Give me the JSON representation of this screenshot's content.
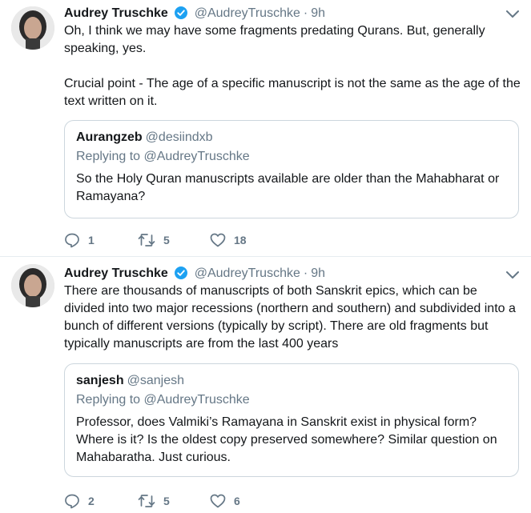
{
  "tweets": [
    {
      "author": "Audrey Truschke",
      "handle": "@AudreyTruschke",
      "separator": "·",
      "time": "9h",
      "text_line1": "Oh, I think we may have some fragments predating Qurans. But, generally speaking, yes.",
      "text_line2": "Crucial point - The age of a specific manuscript is not the same as the age of the text written on it.",
      "quote": {
        "author": "Aurangzeb",
        "handle": "@desiindxb",
        "replying_to": "Replying to @AudreyTruschke",
        "text": "So the Holy Quran manuscripts available are older than the Mahabharat or Ramayana?"
      },
      "replies": "1",
      "retweets": "5",
      "likes": "18"
    },
    {
      "author": "Audrey Truschke",
      "handle": "@AudreyTruschke",
      "separator": "·",
      "time": "9h",
      "text_line1": "There are thousands of manuscripts of both Sanskrit epics, which can be divided into two major recessions (northern and southern) and subdivided into a bunch of different versions (typically by script). There are old fragments but typically manuscripts are from the last 400 years",
      "quote": {
        "author": "sanjesh",
        "handle": "@sanjesh",
        "replying_to": "Replying to @AudreyTruschke",
        "text": "Professor, does Valmiki’s Ramayana in Sanskrit exist in physical form? Where is it? Is the oldest copy preserved somewhere? Similar question on Mahabaratha. Just curious."
      },
      "replies": "2",
      "retweets": "5",
      "likes": "6"
    }
  ],
  "colors": {
    "text": "#14171a",
    "secondary": "#657786",
    "verified": "#1da1f2",
    "border": "#ccd6dd"
  },
  "icons": [
    "avatar",
    "verified-badge-icon",
    "chevron-down-icon",
    "reply-icon",
    "retweet-icon",
    "like-icon"
  ]
}
